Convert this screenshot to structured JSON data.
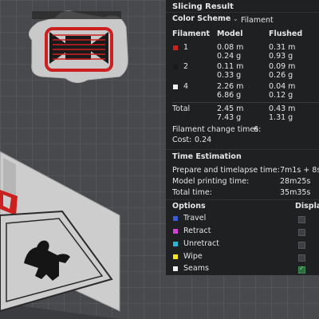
{
  "panel": {
    "title": "Slicing Result",
    "color_scheme_label": "Color Scheme",
    "color_scheme_value": "Filament",
    "columns": {
      "filament": "Filament",
      "model": "Model",
      "flushed": "Flushed"
    },
    "filaments": [
      {
        "id": "1",
        "color": "#cc2020",
        "model_m": "0.08 m",
        "model_g": "0.24 g",
        "flushed_m": "0.31 m",
        "flushed_g": "0.93 g"
      },
      {
        "id": "2",
        "color": "#1a1a1a",
        "model_m": "0.11 m",
        "model_g": "0.33 g",
        "flushed_m": "0.09 m",
        "flushed_g": "0.26 g"
      },
      {
        "id": "4",
        "color": "#f2f2f2",
        "model_m": "2.26 m",
        "model_g": "6.86 g",
        "flushed_m": "0.04 m",
        "flushed_g": "0.12 g"
      }
    ],
    "total": {
      "label": "Total",
      "model_m": "2.45 m",
      "model_g": "7.43 g",
      "flushed_m": "0.43 m",
      "flushed_g": "1.31 g"
    },
    "change_times_label": "Filament change times:",
    "change_times_value": "6",
    "cost_label": "Cost:",
    "cost_value": "0.24",
    "time_title": "Time Estimation",
    "times": [
      {
        "label": "Prepare and timelapse time:",
        "value": "7m1s + 8s"
      },
      {
        "label": "Model printing time:",
        "value": "28m25s"
      },
      {
        "label": "Total time:",
        "value": "35m35s"
      }
    ],
    "options_title": "Options",
    "display_title": "Display",
    "options": [
      {
        "label": "Travel",
        "color": "#3a5bd9",
        "checked": false
      },
      {
        "label": "Retract",
        "color": "#d43fd4",
        "checked": false
      },
      {
        "label": "Unretract",
        "color": "#2ab7d6",
        "checked": false
      },
      {
        "label": "Wipe",
        "color": "#f5e61c",
        "checked": false
      },
      {
        "label": "Seams",
        "color": "#f0f0f0",
        "checked": true
      }
    ]
  }
}
